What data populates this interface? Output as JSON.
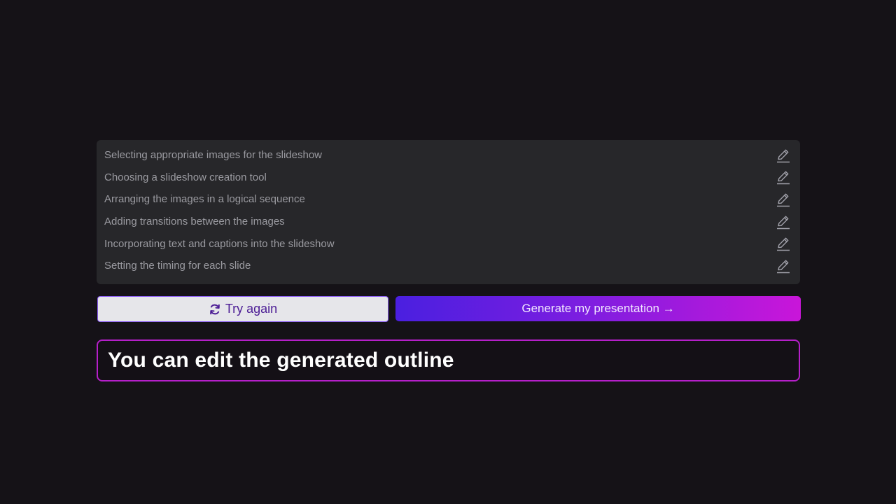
{
  "outline": {
    "items": [
      {
        "label": "Selecting appropriate images for the slideshow"
      },
      {
        "label": "Choosing a slideshow creation tool"
      },
      {
        "label": "Arranging the images in a logical sequence"
      },
      {
        "label": "Adding transitions between the images"
      },
      {
        "label": "Incorporating text and captions into the slideshow"
      },
      {
        "label": "Setting the timing for each slide"
      }
    ],
    "edit_icon": "pencil-icon"
  },
  "actions": {
    "try_again_label": "Try again",
    "try_again_icon": "refresh-icon",
    "generate_label": "Generate my presentation →"
  },
  "caption": {
    "text": "You can edit the generated outline"
  },
  "colors": {
    "background": "#151217",
    "panel": "#27272a",
    "gradient_start": "#4a1fe0",
    "gradient_end": "#c916d9",
    "caption_border": "#b51fc9"
  }
}
